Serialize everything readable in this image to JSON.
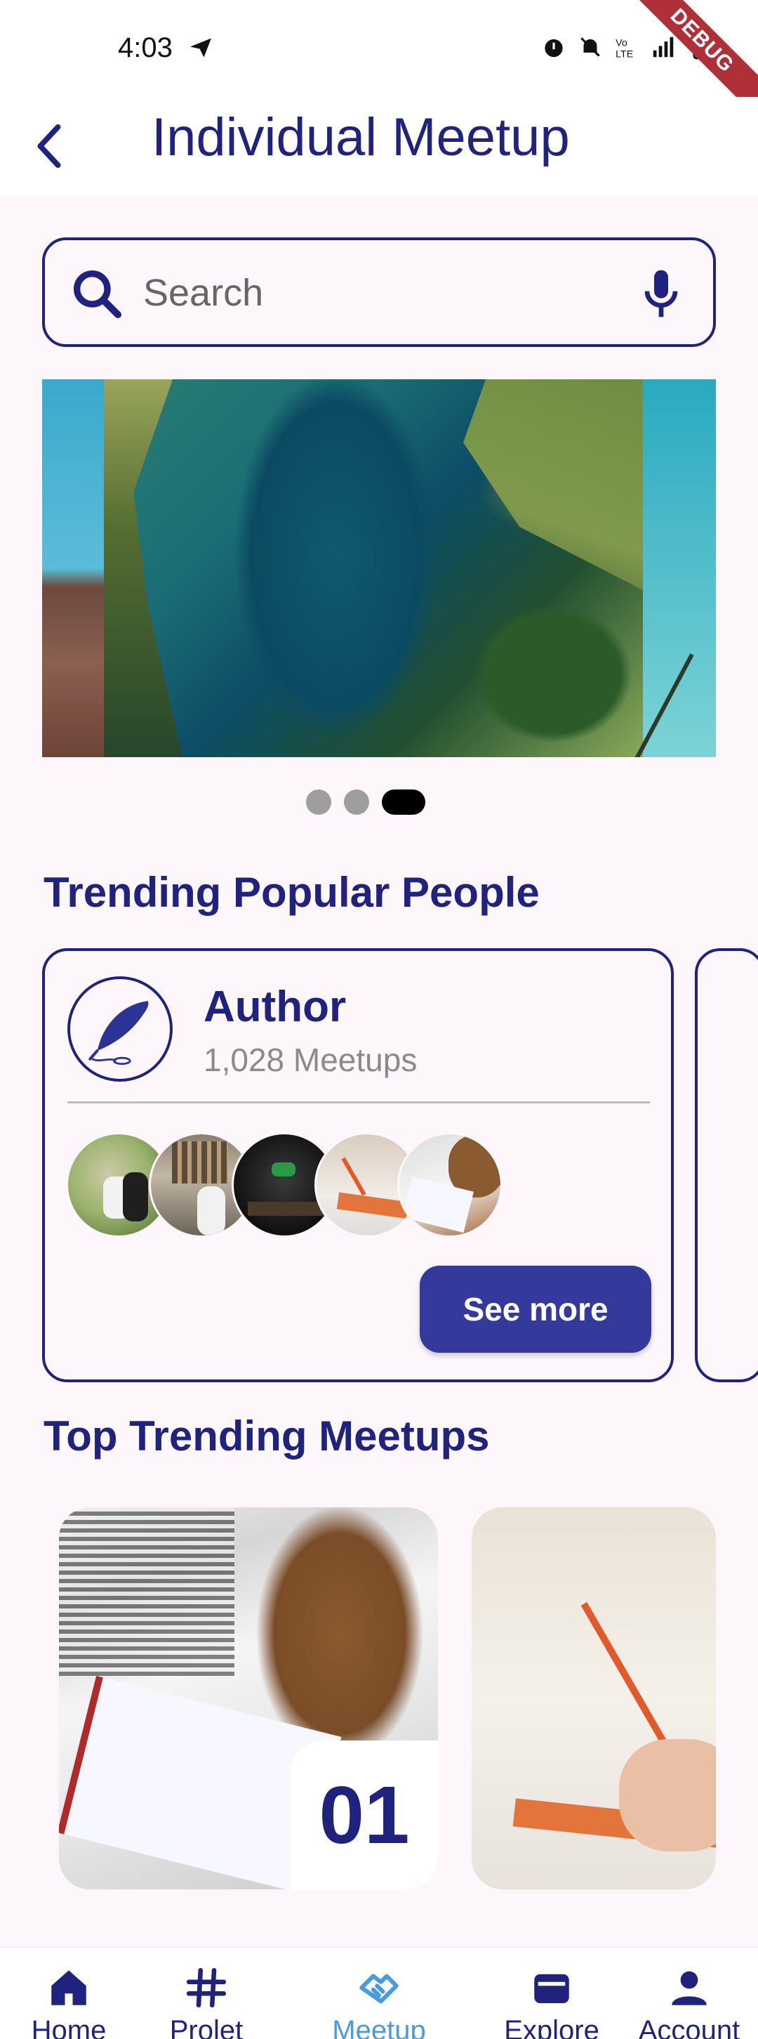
{
  "status_bar": {
    "time": "4:03",
    "debug_label": "DEBUG"
  },
  "header": {
    "title": "Individual Meetup"
  },
  "search": {
    "placeholder": "Search"
  },
  "carousel": {
    "slide_count": 3,
    "active_index": 2
  },
  "trending_people": {
    "title": "Trending Popular People",
    "card": {
      "name": "Author",
      "count": "1,028 Meetups",
      "see_more_label": "See more"
    }
  },
  "trending_meetups": {
    "title": "Top Trending Meetups",
    "items": [
      {
        "rank": "01"
      }
    ]
  },
  "bottom_nav": {
    "items": [
      {
        "label": "Home",
        "icon": "home-icon"
      },
      {
        "label": "Prolet",
        "icon": "hashtag-icon"
      },
      {
        "label": "Meetup",
        "icon": "handshake-icon",
        "active": true
      },
      {
        "label": "Explore",
        "icon": "wallet-icon"
      },
      {
        "label": "Account",
        "icon": "person-icon"
      }
    ]
  },
  "colors": {
    "primary": "#1F237E",
    "button": "#34399B",
    "active_nav": "#4A9AE0",
    "background": "#FDF7FB"
  }
}
